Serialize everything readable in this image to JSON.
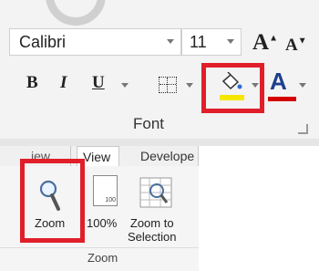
{
  "font_group": {
    "font_name": "Calibri",
    "font_size": "11",
    "grow_label": "A",
    "shrink_label": "A",
    "bold_label": "B",
    "italic_label": "I",
    "underline_label": "U",
    "font_color_label": "A",
    "group_label": "Font",
    "fill_color": "#f5e600",
    "font_color": "#d40000"
  },
  "zoom_group": {
    "tabs": [
      "iew",
      "View",
      "Develope"
    ],
    "zoom_label": "Zoom",
    "hundred_label": "100%",
    "page_icon_text": "100",
    "zoom_selection_label_line1": "Zoom to",
    "zoom_selection_label_line2": "Selection",
    "group_label": "Zoom"
  }
}
